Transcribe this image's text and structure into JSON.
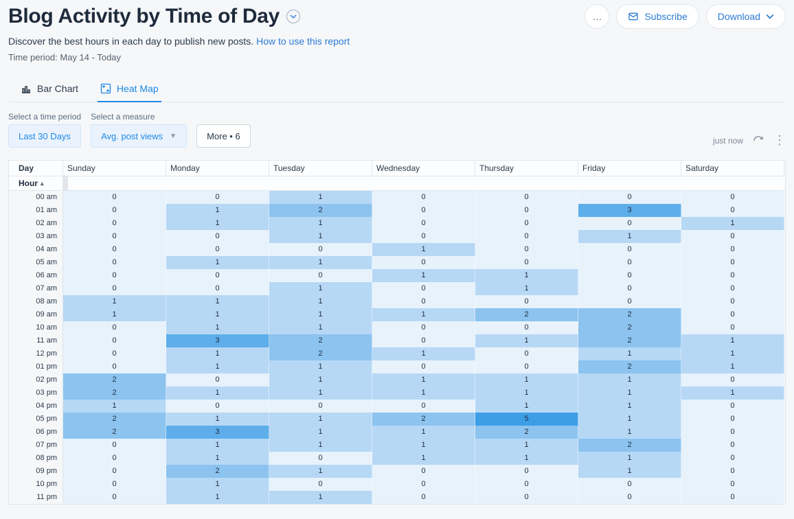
{
  "header": {
    "title": "Blog Activity by Time of Day",
    "subtitle_prefix": "Discover the best hours in each day to publish new posts. ",
    "subtitle_link": "How to use this report",
    "time_period_prefix": "Time period: ",
    "time_period_value": "May 14 - Today",
    "more_button_aria": "…",
    "subscribe_label": "Subscribe",
    "download_label": "Download"
  },
  "tabs": {
    "bar_chart": "Bar Chart",
    "heat_map": "Heat Map"
  },
  "controls": {
    "time_label": "Select a time period",
    "time_value": "Last 30 Days",
    "measure_label": "Select a measure",
    "measure_value": "Avg. post views",
    "more_label": "More • 6",
    "status_text": "just now"
  },
  "heatmap": {
    "day_header": "Day",
    "hour_header": "Hour",
    "days": [
      "Sunday",
      "Monday",
      "Tuesday",
      "Wednesday",
      "Thursday",
      "Friday",
      "Saturday"
    ],
    "hours": [
      "00 am",
      "01 am",
      "02 am",
      "03 am",
      "04 am",
      "05 am",
      "06 am",
      "07 am",
      "08 am",
      "09 am",
      "10 am",
      "11 am",
      "12 pm",
      "01 pm",
      "02 pm",
      "03 pm",
      "04 pm",
      "05 pm",
      "06 pm",
      "07 pm",
      "08 pm",
      "09 pm",
      "10 pm",
      "11 pm"
    ]
  },
  "chart_data": {
    "type": "heatmap",
    "title": "Blog Activity by Time of Day",
    "xlabel": "Day",
    "ylabel": "Hour",
    "x_categories": [
      "Sunday",
      "Monday",
      "Tuesday",
      "Wednesday",
      "Thursday",
      "Friday",
      "Saturday"
    ],
    "y_categories": [
      "00 am",
      "01 am",
      "02 am",
      "03 am",
      "04 am",
      "05 am",
      "06 am",
      "07 am",
      "08 am",
      "09 am",
      "10 am",
      "11 am",
      "12 pm",
      "01 pm",
      "02 pm",
      "03 pm",
      "04 pm",
      "05 pm",
      "06 pm",
      "07 pm",
      "08 pm",
      "09 pm",
      "10 pm",
      "11 pm"
    ],
    "values": [
      [
        0,
        0,
        1,
        0,
        0,
        0,
        0
      ],
      [
        0,
        1,
        2,
        0,
        0,
        3,
        0
      ],
      [
        0,
        1,
        1,
        0,
        0,
        0,
        1
      ],
      [
        0,
        0,
        1,
        0,
        0,
        1,
        0
      ],
      [
        0,
        0,
        0,
        1,
        0,
        0,
        0
      ],
      [
        0,
        1,
        1,
        0,
        0,
        0,
        0
      ],
      [
        0,
        0,
        0,
        1,
        1,
        0,
        0
      ],
      [
        0,
        0,
        1,
        0,
        1,
        0,
        0
      ],
      [
        1,
        1,
        1,
        0,
        0,
        0,
        0
      ],
      [
        1,
        1,
        1,
        1,
        2,
        2,
        0
      ],
      [
        0,
        1,
        1,
        0,
        0,
        2,
        0
      ],
      [
        0,
        3,
        2,
        0,
        1,
        2,
        1
      ],
      [
        0,
        1,
        2,
        1,
        0,
        1,
        1
      ],
      [
        0,
        1,
        1,
        0,
        0,
        2,
        1
      ],
      [
        2,
        0,
        1,
        1,
        1,
        1,
        0
      ],
      [
        2,
        1,
        1,
        1,
        1,
        1,
        1
      ],
      [
        1,
        0,
        0,
        0,
        1,
        1,
        0
      ],
      [
        2,
        1,
        1,
        2,
        5,
        1,
        0
      ],
      [
        2,
        3,
        1,
        1,
        2,
        1,
        0
      ],
      [
        0,
        1,
        1,
        1,
        1,
        2,
        0
      ],
      [
        0,
        1,
        0,
        1,
        1,
        1,
        0
      ],
      [
        0,
        2,
        1,
        0,
        0,
        1,
        0
      ],
      [
        0,
        1,
        0,
        0,
        0,
        0,
        0
      ],
      [
        0,
        1,
        1,
        0,
        0,
        0,
        0
      ]
    ],
    "value_range": [
      0,
      5
    ],
    "colorscale": {
      "0": "#e7f2fb",
      "1": "#b6d8f5",
      "2": "#8cc3ef",
      "3": "#5daeea",
      "5": "#3d9de5"
    }
  }
}
